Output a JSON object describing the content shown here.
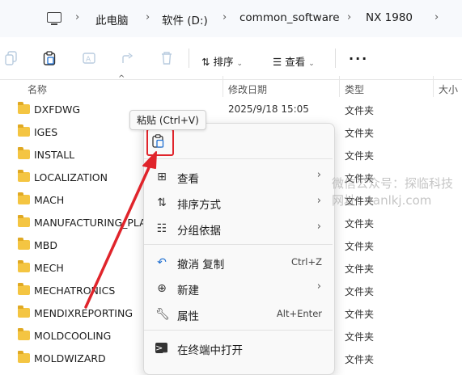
{
  "address_bar": {
    "segments": [
      "此电脑",
      "软件 (D:)",
      "common_software",
      "NX 1980"
    ]
  },
  "toolbar": {
    "sort_label": "排序",
    "view_label": "查看"
  },
  "columns": {
    "name": "名称",
    "date": "修改日期",
    "type": "类型",
    "size": "大小"
  },
  "files": [
    {
      "name": "DXFDWG",
      "date": "2025/9/18 15:05",
      "type": "文件夹"
    },
    {
      "name": "IGES",
      "date": "",
      "type": "文件夹"
    },
    {
      "name": "INSTALL",
      "date": "",
      "type": "文件夹"
    },
    {
      "name": "LOCALIZATION",
      "date": "",
      "type": "文件夹"
    },
    {
      "name": "MACH",
      "date": "",
      "type": "文件夹"
    },
    {
      "name": "MANUFACTURING_PLA",
      "date": "",
      "type": "文件夹"
    },
    {
      "name": "MBD",
      "date": "",
      "type": "文件夹"
    },
    {
      "name": "MECH",
      "date": "",
      "type": "文件夹"
    },
    {
      "name": "MECHATRONICS",
      "date": "",
      "type": "文件夹"
    },
    {
      "name": "MENDIXREPORTING",
      "date": "",
      "type": "文件夹"
    },
    {
      "name": "MOLDCOOLING",
      "date": "",
      "type": "文件夹"
    },
    {
      "name": "MOLDWIZARD",
      "date": "",
      "type": "文件夹"
    }
  ],
  "tooltip": "粘贴 (Ctrl+V)",
  "context_menu": {
    "view": "查看",
    "sort_by": "排序方式",
    "group_by": "分组依据",
    "undo": "撤消 复制",
    "undo_shortcut": "Ctrl+Z",
    "new": "新建",
    "properties": "属性",
    "properties_shortcut": "Alt+Enter",
    "open_in_terminal": "在终端中打开"
  },
  "watermark": {
    "line1": "微信公众号：探临科技",
    "line2": "网址：tanlkj.com"
  },
  "colors": {
    "highlight_red": "#e0242b",
    "folder_yellow": "#f4c542",
    "menu_bg": "#f9f9f9"
  }
}
